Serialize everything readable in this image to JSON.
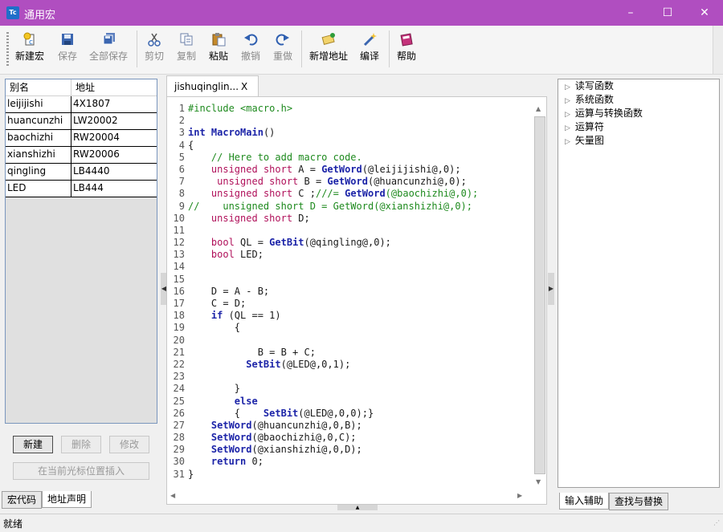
{
  "window": {
    "app_icon_text": "Tc",
    "title": "通用宏",
    "min": "–",
    "max": "☐",
    "close": "✕"
  },
  "toolbar": {
    "new_macro": "新建宏",
    "save": "保存",
    "save_all": "全部保存",
    "cut": "剪切",
    "copy": "复制",
    "paste": "粘贴",
    "undo": "撤销",
    "redo": "重做",
    "add_address": "新增地址",
    "compile": "编译",
    "help": "帮助"
  },
  "alias_table": {
    "headers": [
      "别名",
      "地址"
    ],
    "rows": [
      [
        "leijijishi",
        "4X1807"
      ],
      [
        "huancunzhi",
        "LW20002"
      ],
      [
        "baochizhi",
        "RW20004"
      ],
      [
        "xianshizhi",
        "RW20006"
      ],
      [
        "qingling",
        "LB4440"
      ],
      [
        "LED",
        "LB444"
      ]
    ]
  },
  "left_buttons": {
    "new": "新建",
    "delete": "删除",
    "modify": "修改",
    "insert": "在当前光标位置插入"
  },
  "left_tabs": {
    "macro_code": "宏代码",
    "address_decl": "地址声明"
  },
  "editor": {
    "tab_label": "jishuqinglin...",
    "tab_close": "X",
    "lines": [
      {
        "n": "1",
        "t": "#include <macro.h>"
      },
      {
        "n": "2",
        "t": ""
      },
      {
        "n": "3",
        "t": "int MacroMain()"
      },
      {
        "n": "4",
        "t": "{"
      },
      {
        "n": "5",
        "t": "    // Here to add macro code."
      },
      {
        "n": "6",
        "t": "    unsigned short A = GetWord(@leijijishi@,0);"
      },
      {
        "n": "7",
        "t": "     unsigned short B = GetWord(@huancunzhi@,0);"
      },
      {
        "n": "8",
        "t": "    unsigned short C ;///= GetWord(@baochizhi@,0);"
      },
      {
        "n": "9",
        "t": "//    unsigned short D = GetWord(@xianshizhi@,0);"
      },
      {
        "n": "10",
        "t": "    unsigned short D;"
      },
      {
        "n": "11",
        "t": ""
      },
      {
        "n": "12",
        "t": "    bool QL = GetBit(@qingling@,0);"
      },
      {
        "n": "13",
        "t": "    bool LED;"
      },
      {
        "n": "14",
        "t": ""
      },
      {
        "n": "15",
        "t": ""
      },
      {
        "n": "16",
        "t": "    D = A - B;"
      },
      {
        "n": "17",
        "t": "    C = D;"
      },
      {
        "n": "18",
        "t": "    if (QL == 1)"
      },
      {
        "n": "19",
        "t": "        {"
      },
      {
        "n": "20",
        "t": ""
      },
      {
        "n": "21",
        "t": "            B = B + C;"
      },
      {
        "n": "22",
        "t": "          SetBit(@LED@,0,1);"
      },
      {
        "n": "23",
        "t": ""
      },
      {
        "n": "24",
        "t": "        }"
      },
      {
        "n": "25",
        "t": "        else"
      },
      {
        "n": "26",
        "t": "        {    SetBit(@LED@,0,0);}"
      },
      {
        "n": "27",
        "t": "    SetWord(@huancunzhi@,0,B);"
      },
      {
        "n": "28",
        "t": "    SetWord(@baochizhi@,0,C);"
      },
      {
        "n": "29",
        "t": "    SetWord(@xianshizhi@,0,D);"
      },
      {
        "n": "30",
        "t": "    return 0;"
      },
      {
        "n": "31",
        "t": "}"
      }
    ]
  },
  "tree": {
    "items": [
      "读写函数",
      "系统函数",
      "运算与转换函数",
      "运算符",
      "矢量图"
    ]
  },
  "right_tabs": {
    "input_assist": "输入辅助",
    "find_replace": "查找与替换"
  },
  "status": {
    "text": "就绪"
  }
}
